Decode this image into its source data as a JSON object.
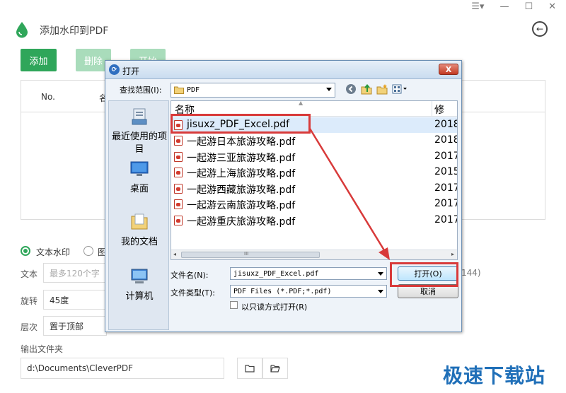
{
  "app": {
    "title": "添加水印到PDF",
    "win_menu": "☰▾",
    "win_min": "—",
    "win_max": "☐",
    "win_close": "✕",
    "back": "←"
  },
  "toolbar": {
    "add": "添加",
    "delete": "删除",
    "start": "开始"
  },
  "table": {
    "col_no": "No.",
    "col_name": "名"
  },
  "watermark_type": {
    "text_option": "文本水印",
    "image_option": "图"
  },
  "form": {
    "text_label": "文本",
    "text_placeholder": "最多120个字",
    "text_hint": "144)",
    "rotate_label": "旋转",
    "rotate_value": "45度",
    "layer_label": "层次",
    "layer_value": "置于顶部",
    "output_label": "输出文件夹",
    "output_path": "d:\\Documents\\CleverPDF"
  },
  "site_watermark": "极速下载站",
  "dialog": {
    "title": "打开",
    "close": "X",
    "look_in_label": "查找范围(I):",
    "look_in_value": "PDF",
    "places": [
      {
        "label": "最近使用的项目"
      },
      {
        "label": "桌面"
      },
      {
        "label": "我的文档"
      },
      {
        "label": "计算机"
      }
    ],
    "columns": {
      "name": "名称",
      "modified": "修改|"
    },
    "files": [
      {
        "name": "jisuxz_PDF_Excel.pdf",
        "date": "2018"
      },
      {
        "name": "一起游日本旅游攻略.pdf",
        "date": "2018"
      },
      {
        "name": "一起游三亚旅游攻略.pdf",
        "date": "2017"
      },
      {
        "name": "一起游上海旅游攻略.pdf",
        "date": "2015"
      },
      {
        "name": "一起游西藏旅游攻略.pdf",
        "date": "2017"
      },
      {
        "name": "一起游云南旅游攻略.pdf",
        "date": "2017"
      },
      {
        "name": "一起游重庆旅游攻略.pdf",
        "date": "2017"
      }
    ],
    "scroll_grip": "III",
    "filename_label": "文件名(N):",
    "filename_value": "jisuxz_PDF_Excel.pdf",
    "filetype_label": "文件类型(T):",
    "filetype_value": "PDF Files (*.PDF;*.pdf)",
    "readonly_label": "以只读方式打开(R)",
    "open_button": "打开(O)",
    "cancel_button": "取消"
  },
  "colors": {
    "green": "#2fa65a",
    "green_disabled": "#a9dcbb",
    "highlight": "#d83a3a",
    "brand_blue": "#1f6fb8"
  }
}
